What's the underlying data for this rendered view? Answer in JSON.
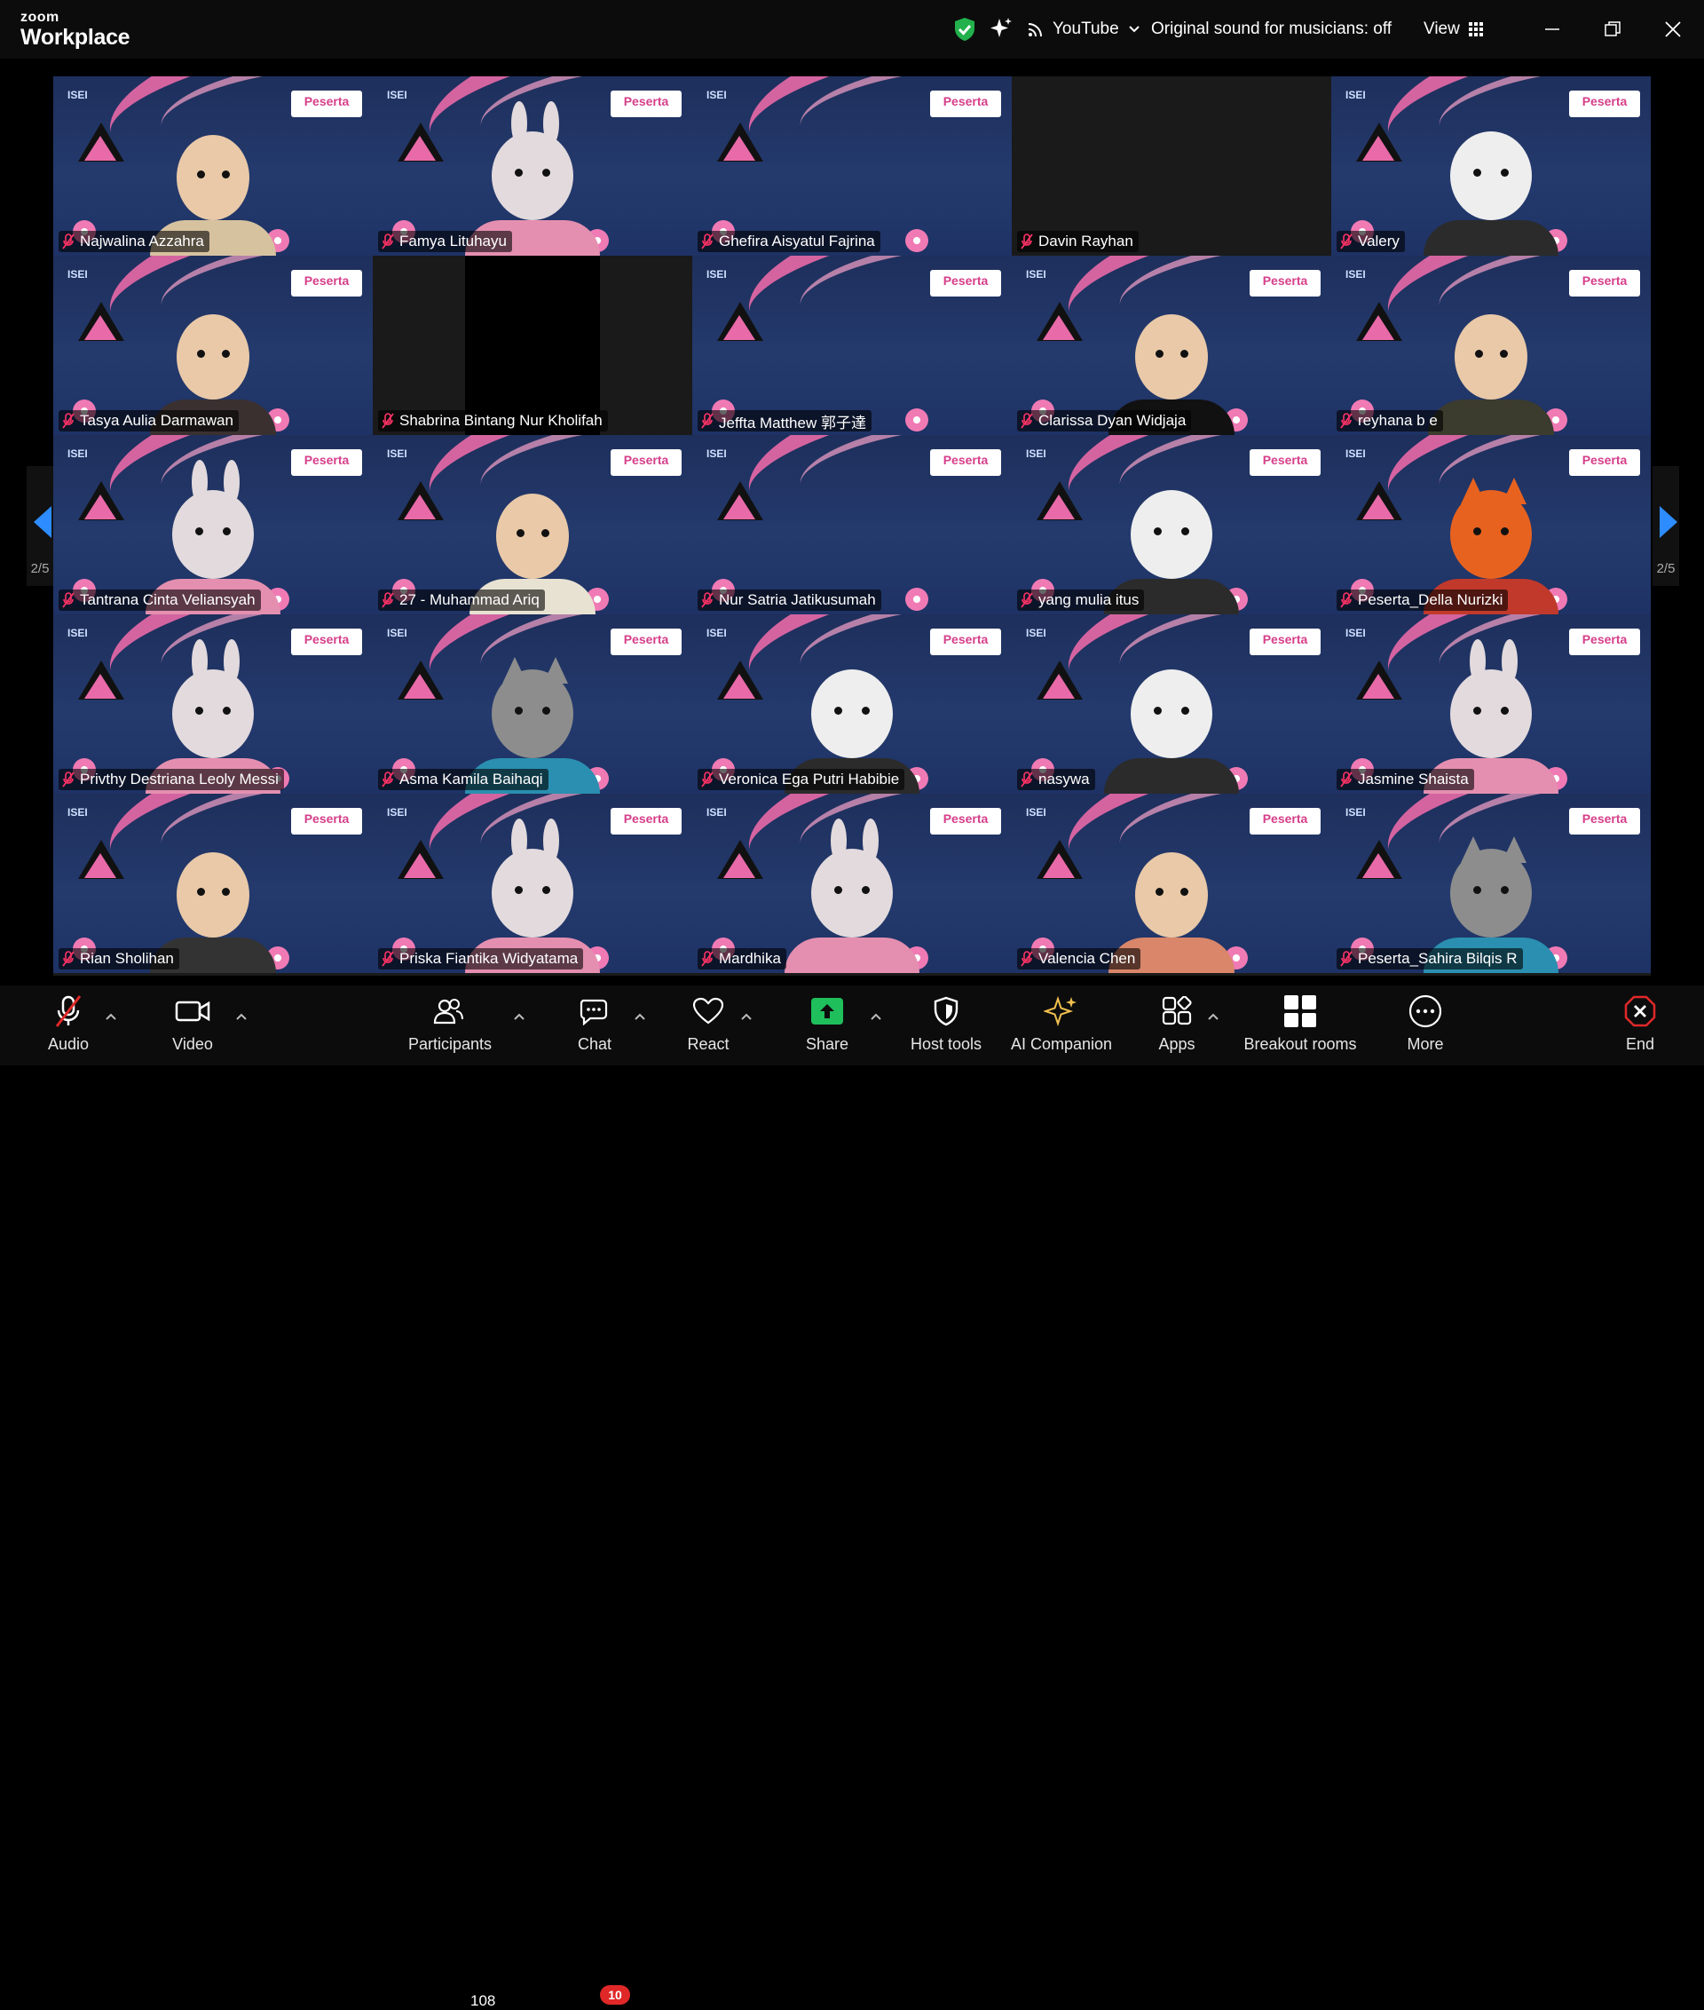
{
  "app": {
    "brand_small": "zoom",
    "brand_big": "Workplace"
  },
  "topbar": {
    "stream_label": "YouTube",
    "sound_label": "Original sound for musicians: off",
    "view_label": "View",
    "icons": [
      "security-shield-icon",
      "ai-sparkle-icon",
      "live-stream-icon",
      "chevron-down-icon",
      "grid-view-icon",
      "minimize-icon",
      "restore-icon",
      "close-icon"
    ]
  },
  "badge_text": "Peserta",
  "logo_text": "ISEI",
  "pager": {
    "left_text": "2/5",
    "right_text": "2/5"
  },
  "participants": [
    {
      "name": "Najwalina Azzahra",
      "kind": "person",
      "color": "#d7c2a0"
    },
    {
      "name": "Famya Lituhayu",
      "kind": "bunny",
      "color": "#e58fb0"
    },
    {
      "name": "Ghefira Aisyatul Fajrina",
      "kind": "none",
      "color": ""
    },
    {
      "name": "Davin Rayhan",
      "kind": "off",
      "color": ""
    },
    {
      "name": "Valery",
      "kind": "bear",
      "color": "#2b2b2b"
    },
    {
      "name": "Tasya Aulia Darmawan",
      "kind": "person",
      "color": "#3a3030"
    },
    {
      "name": "Shabrina Bintang Nur Kholifah",
      "kind": "black",
      "color": ""
    },
    {
      "name": "Jeffta Matthew 郭子達",
      "kind": "none",
      "color": ""
    },
    {
      "name": "Clarissa Dyan Widjaja",
      "kind": "person",
      "color": "#111111"
    },
    {
      "name": "reyhana b e",
      "kind": "person",
      "color": "#3b3b2e"
    },
    {
      "name": "Tantrana Cinta Veliansyah",
      "kind": "bunny",
      "color": "#e58fb0"
    },
    {
      "name": "27 - Muhammad Ariq",
      "kind": "person",
      "color": "#e8e2d2"
    },
    {
      "name": "Nur Satria Jatikusumah",
      "kind": "none",
      "color": ""
    },
    {
      "name": "yang mulia itus",
      "kind": "bear",
      "color": "#2b2b2b"
    },
    {
      "name": "Peserta_Della Nurizki",
      "kind": "fox",
      "color": "#c0392b"
    },
    {
      "name": "Privthy Destriana Leoly Messi",
      "kind": "bunny",
      "color": "#e58fb0"
    },
    {
      "name": "Asma Kamila Baihaqi",
      "kind": "raccoon",
      "color": "#2a8fb0"
    },
    {
      "name": "Veronica Ega Putri Habibie",
      "kind": "bear",
      "color": "#2b2b2b"
    },
    {
      "name": "nasywa",
      "kind": "bear",
      "color": "#2b2b2b"
    },
    {
      "name": "Jasmine Shaista",
      "kind": "bunny",
      "color": "#e58fb0"
    },
    {
      "name": "Rian Sholihan",
      "kind": "boy",
      "color": "#333333"
    },
    {
      "name": "Priska Fiantika Widyatama",
      "kind": "bunny",
      "color": "#e58fb0"
    },
    {
      "name": "Mardhika",
      "kind": "bunny",
      "color": "#e58fb0"
    },
    {
      "name": "Valencia Chen",
      "kind": "girl",
      "color": "#d9866a"
    },
    {
      "name": "Peserta_Sahira Bilqis R",
      "kind": "raccoon",
      "color": "#2a8fb0"
    }
  ],
  "toolbar": {
    "audio": "Audio",
    "video": "Video",
    "participants": "Participants",
    "participants_count": "108",
    "chat": "Chat",
    "chat_badge": "10",
    "react": "React",
    "share": "Share",
    "host_tools": "Host tools",
    "ai_companion": "AI Companion",
    "apps": "Apps",
    "breakout": "Breakout rooms",
    "more": "More",
    "end": "End"
  },
  "colors": {
    "accent_blue": "#2d8cff",
    "share_green": "#1fbf5c",
    "danger_red": "#e02828",
    "ai_gold": "#f2c14e",
    "shield_green": "#22b14c"
  }
}
